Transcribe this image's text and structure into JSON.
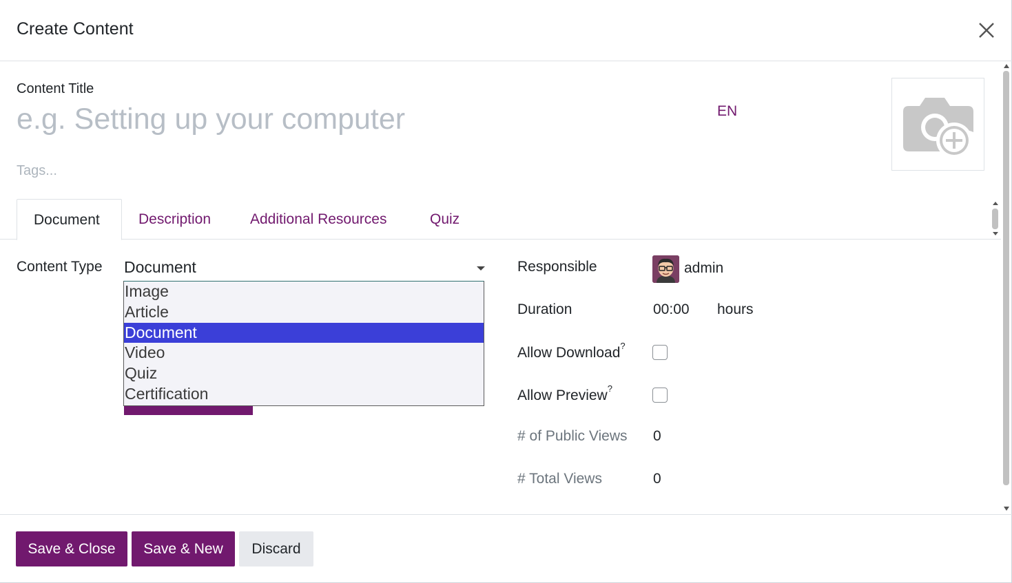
{
  "dialog": {
    "title": "Create Content"
  },
  "form": {
    "title_label": "Content Title",
    "title_placeholder": "e.g. Setting up your computer",
    "lang": "EN",
    "tags_placeholder": "Tags..."
  },
  "tabs": [
    {
      "label": "Document",
      "active": true
    },
    {
      "label": "Description"
    },
    {
      "label": "Additional Resources"
    },
    {
      "label": "Quiz"
    }
  ],
  "content_type": {
    "label": "Content Type",
    "value": "Document",
    "options": [
      "Image",
      "Article",
      "Document",
      "Video",
      "Quiz",
      "Certification"
    ],
    "selected_index": 2
  },
  "fields": {
    "responsible_label": "Responsible",
    "responsible_value": "admin",
    "duration_label": "Duration",
    "duration_value": "00:00",
    "duration_unit": "hours",
    "allow_download_label": "Allow Download",
    "allow_preview_label": "Allow Preview",
    "help_mark": "?",
    "public_views_label": "# of Public Views",
    "public_views_value": "0",
    "total_views_label": "# Total Views",
    "total_views_value": "0"
  },
  "footer": {
    "save_close": "Save & Close",
    "save_new": "Save & New",
    "discard": "Discard"
  },
  "colors": {
    "brand": "#71196e",
    "selected_option": "#3b3fd8"
  }
}
